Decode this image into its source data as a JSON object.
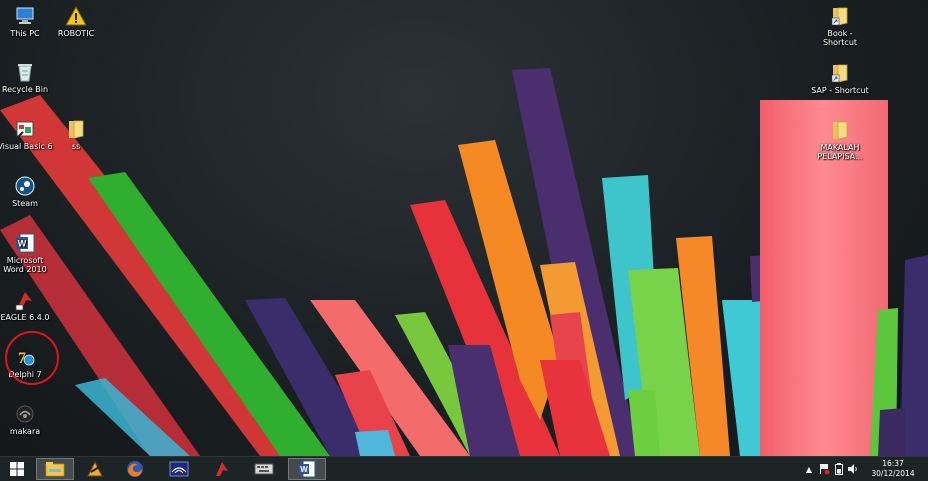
{
  "desktop": {
    "icons_left": [
      {
        "label": "This PC",
        "icon": "computer-icon"
      },
      {
        "label": "ROBOTIC",
        "icon": "warning-icon"
      },
      {
        "label": "Recycle Bin",
        "icon": "recycle-bin-icon"
      },
      {
        "label": "Visual Basic 6",
        "icon": "visual-basic-icon"
      },
      {
        "label": "ss",
        "icon": "folder-icon"
      },
      {
        "label": "Steam",
        "icon": "steam-icon"
      },
      {
        "label": "Microsoft Word 2010",
        "icon": "word-icon"
      },
      {
        "label": "EAGLE 6.4.0",
        "icon": "eagle-icon"
      },
      {
        "label": "Delphi 7",
        "icon": "delphi-icon"
      },
      {
        "label": "makara",
        "icon": "makara-icon"
      }
    ],
    "icons_right": [
      {
        "label": "Book - Shortcut",
        "icon": "folder-shortcut-icon"
      },
      {
        "label": "SAP - Shortcut",
        "icon": "folder-shortcut-icon"
      },
      {
        "label": "MAKALAH PELAPISA...",
        "icon": "folder-icon"
      }
    ]
  },
  "taskbar": {
    "apps": [
      {
        "icon": "windows-start-icon"
      },
      {
        "icon": "file-explorer-icon"
      },
      {
        "icon": "winamp-icon"
      },
      {
        "icon": "firefox-icon"
      },
      {
        "icon": "network-app-icon"
      },
      {
        "icon": "eagle-icon"
      },
      {
        "icon": "keyboard-icon"
      },
      {
        "icon": "word-icon"
      }
    ],
    "tray": {
      "time": "16:37",
      "date": "30/12/2014"
    }
  },
  "colors": {
    "taskbar_bg": "#1c2426",
    "highlight": "#e0141b"
  }
}
